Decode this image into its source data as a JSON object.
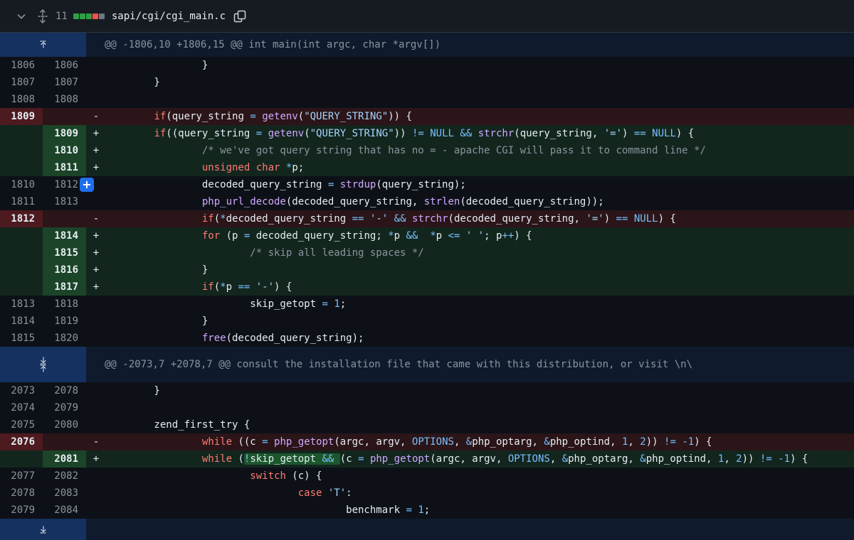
{
  "file": {
    "changes": "11",
    "path": "sapi/cgi/cgi_main.c",
    "diffstat": [
      "#2ea043",
      "#2ea043",
      "#2ea043",
      "#f85149",
      "#6e7681"
    ]
  },
  "hunks": [
    "@@ -1806,10 +1806,15 @@ int main(int argc, char *argv[])",
    "@@ -2073,7 +2078,7 @@ consult the installation file that came with this distribution, or visit \\n\\"
  ],
  "lines": [
    {
      "old": "1806",
      "new": "1806",
      "sign": "",
      "type": "ctx",
      "code": "                }"
    },
    {
      "old": "1807",
      "new": "1807",
      "sign": "",
      "type": "ctx",
      "code": "        }"
    },
    {
      "old": "1808",
      "new": "1808",
      "sign": "",
      "type": "ctx",
      "code": ""
    },
    {
      "old": "1809",
      "new": "",
      "sign": "-",
      "type": "del",
      "code": "        if(query_string = getenv(\"QUERY_STRING\")) {"
    },
    {
      "old": "",
      "new": "1809",
      "sign": "+",
      "type": "add",
      "code": "        if((query_string = getenv(\"QUERY_STRING\")) != NULL && strchr(query_string, '=') == NULL) {"
    },
    {
      "old": "",
      "new": "1810",
      "sign": "+",
      "type": "add",
      "code": "                /* we've got query string that has no = - apache CGI will pass it to command line */"
    },
    {
      "old": "",
      "new": "1811",
      "sign": "+",
      "type": "add",
      "code": "                unsigned char *p;"
    },
    {
      "old": "1810",
      "new": "1812",
      "sign": "",
      "type": "ctx",
      "code": "                decoded_query_string = strdup(query_string);"
    },
    {
      "old": "1811",
      "new": "1813",
      "sign": "",
      "type": "ctx",
      "code": "                php_url_decode(decoded_query_string, strlen(decoded_query_string));"
    },
    {
      "old": "1812",
      "new": "",
      "sign": "-",
      "type": "del",
      "code": "                if(*decoded_query_string == '-' && strchr(decoded_query_string, '=') == NULL) {"
    },
    {
      "old": "",
      "new": "1814",
      "sign": "+",
      "type": "add",
      "code": "                for (p = decoded_query_string; *p &&  *p <= ' '; p++) {"
    },
    {
      "old": "",
      "new": "1815",
      "sign": "+",
      "type": "add",
      "code": "                        /* skip all leading spaces */"
    },
    {
      "old": "",
      "new": "1816",
      "sign": "+",
      "type": "add",
      "code": "                }"
    },
    {
      "old": "",
      "new": "1817",
      "sign": "+",
      "type": "add",
      "code": "                if(*p == '-') {"
    },
    {
      "old": "1813",
      "new": "1818",
      "sign": "",
      "type": "ctx",
      "code": "                        skip_getopt = 1;"
    },
    {
      "old": "1814",
      "new": "1819",
      "sign": "",
      "type": "ctx",
      "code": "                }"
    },
    {
      "old": "1815",
      "new": "1820",
      "sign": "",
      "type": "ctx",
      "code": "                free(decoded_query_string);"
    },
    {
      "old": "2073",
      "new": "2078",
      "sign": "",
      "type": "ctx",
      "code": "        }"
    },
    {
      "old": "2074",
      "new": "2079",
      "sign": "",
      "type": "ctx",
      "code": ""
    },
    {
      "old": "2075",
      "new": "2080",
      "sign": "",
      "type": "ctx",
      "code": "        zend_first_try {"
    },
    {
      "old": "2076",
      "new": "",
      "sign": "-",
      "type": "del",
      "code": "                while ((c = php_getopt(argc, argv, OPTIONS, &php_optarg, &php_optind, 1, 2)) != -1) {"
    },
    {
      "old": "",
      "new": "2081",
      "sign": "+",
      "type": "add",
      "code": "                while (!skip_getopt && (c = php_getopt(argc, argv, OPTIONS, &php_optarg, &php_optind, 1, 2)) != -1) {"
    },
    {
      "old": "2077",
      "new": "2082",
      "sign": "",
      "type": "ctx",
      "code": "                        switch (c) {"
    },
    {
      "old": "2078",
      "new": "2083",
      "sign": "",
      "type": "ctx",
      "code": "                                case 'T':"
    },
    {
      "old": "2079",
      "new": "2084",
      "sign": "",
      "type": "ctx",
      "code": "                                        benchmark = 1;"
    }
  ],
  "icons": {
    "collapse": "chevron-down-icon",
    "expand_all": "unfold-icon",
    "copy": "copy-icon",
    "expand_up": "expand-up-icon",
    "expand_down": "expand-down-icon",
    "add_comment": "plus-icon"
  }
}
